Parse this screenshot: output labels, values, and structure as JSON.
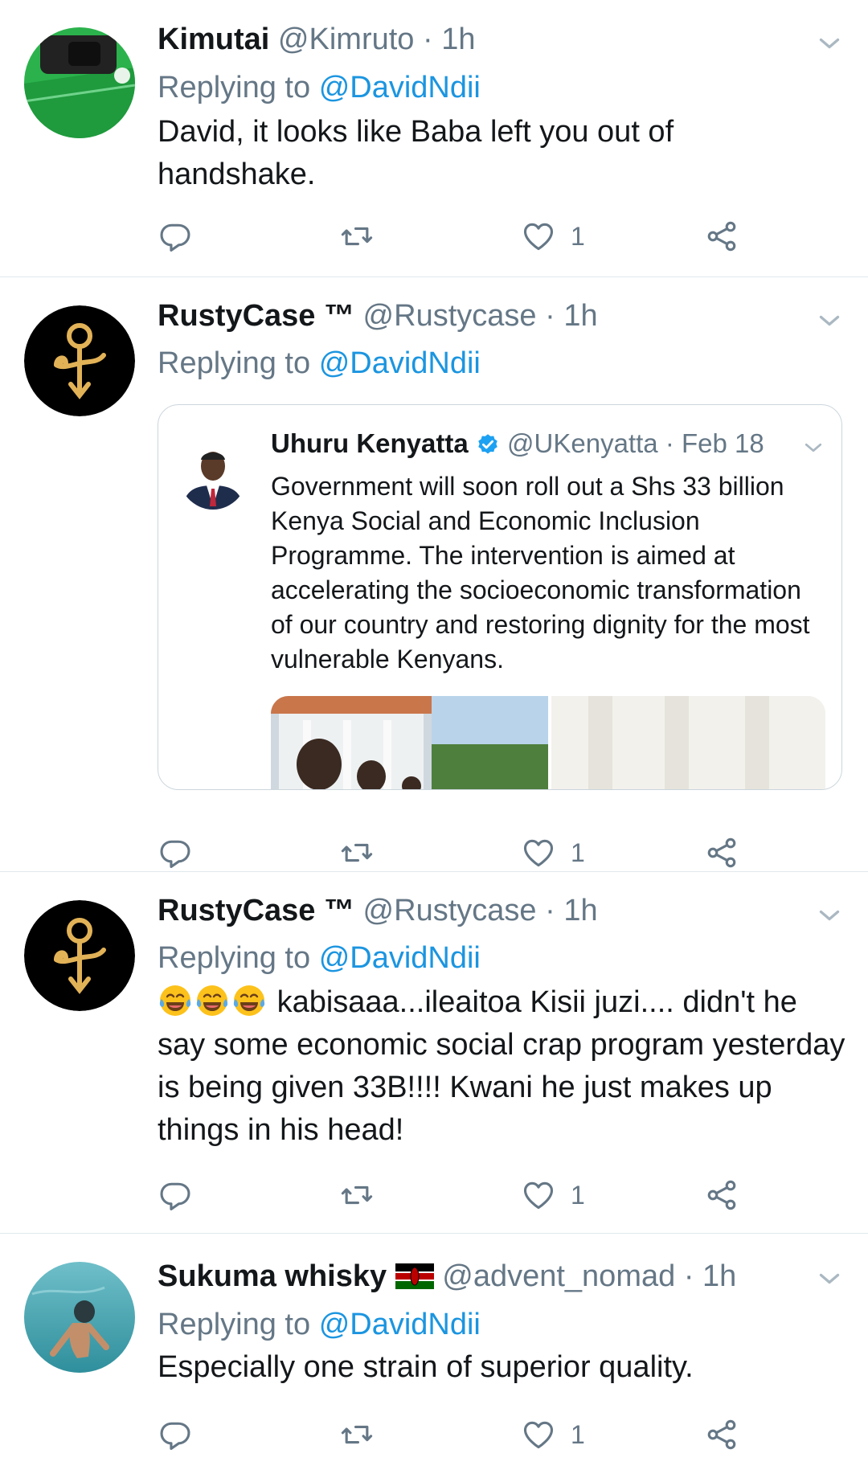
{
  "colors": {
    "link": "#1b95e0",
    "secondary": "#657786",
    "text": "#14171a",
    "divider": "#e1e8ed"
  },
  "tweets": [
    {
      "name": "Kimutai",
      "handle": "@Kimruto",
      "dot": "·",
      "time": "1h",
      "replying_prefix": "Replying to",
      "replying_to": "@DavidNdii",
      "text": "David, it looks like Baba left you out of handshake.",
      "likes": "1",
      "avatar_icon": "jersey-avatar-icon"
    },
    {
      "name": "RustyCase",
      "tm": "™",
      "handle": "@Rustycase",
      "dot": "·",
      "time": "1h",
      "replying_prefix": "Replying to",
      "replying_to": "@DavidNdii",
      "likes": "1",
      "avatar_icon": "love-symbol-avatar-icon",
      "quote": {
        "name": "Uhuru Kenyatta",
        "verified_icon": "verified-badge-icon",
        "handle": "@UKenyatta",
        "dot": "·",
        "date": "Feb 18",
        "text": "Government will soon roll out a Shs 33 billion Kenya Social and Economic Inclusion Programme. The intervention is aimed at accelerating the socioeconomic transformation of our country and restoring dignity for the most vulnerable Kenyans."
      }
    },
    {
      "name": "RustyCase",
      "tm": "™",
      "handle": "@Rustycase",
      "dot": "·",
      "time": "1h",
      "replying_prefix": "Replying to",
      "replying_to": "@DavidNdii",
      "emoji_icon": "tears-of-joy-emoji-icon",
      "text": "kabisaaa...ileaitoa Kisii juzi.... didn't he say some economic social crap program yesterday is being given 33B!!!! Kwani he just makes up things in his head!",
      "likes": "1",
      "avatar_icon": "love-symbol-avatar-icon"
    },
    {
      "name": "Sukuma whisky",
      "flag_icon": "kenya-flag-icon",
      "handle": "@advent_nomad",
      "dot": "·",
      "time": "1h",
      "replying_prefix": "Replying to",
      "replying_to": "@DavidNdii",
      "text": "Especially one strain of superior quality.",
      "likes": "1",
      "avatar_icon": "underwater-avatar-icon"
    }
  ]
}
